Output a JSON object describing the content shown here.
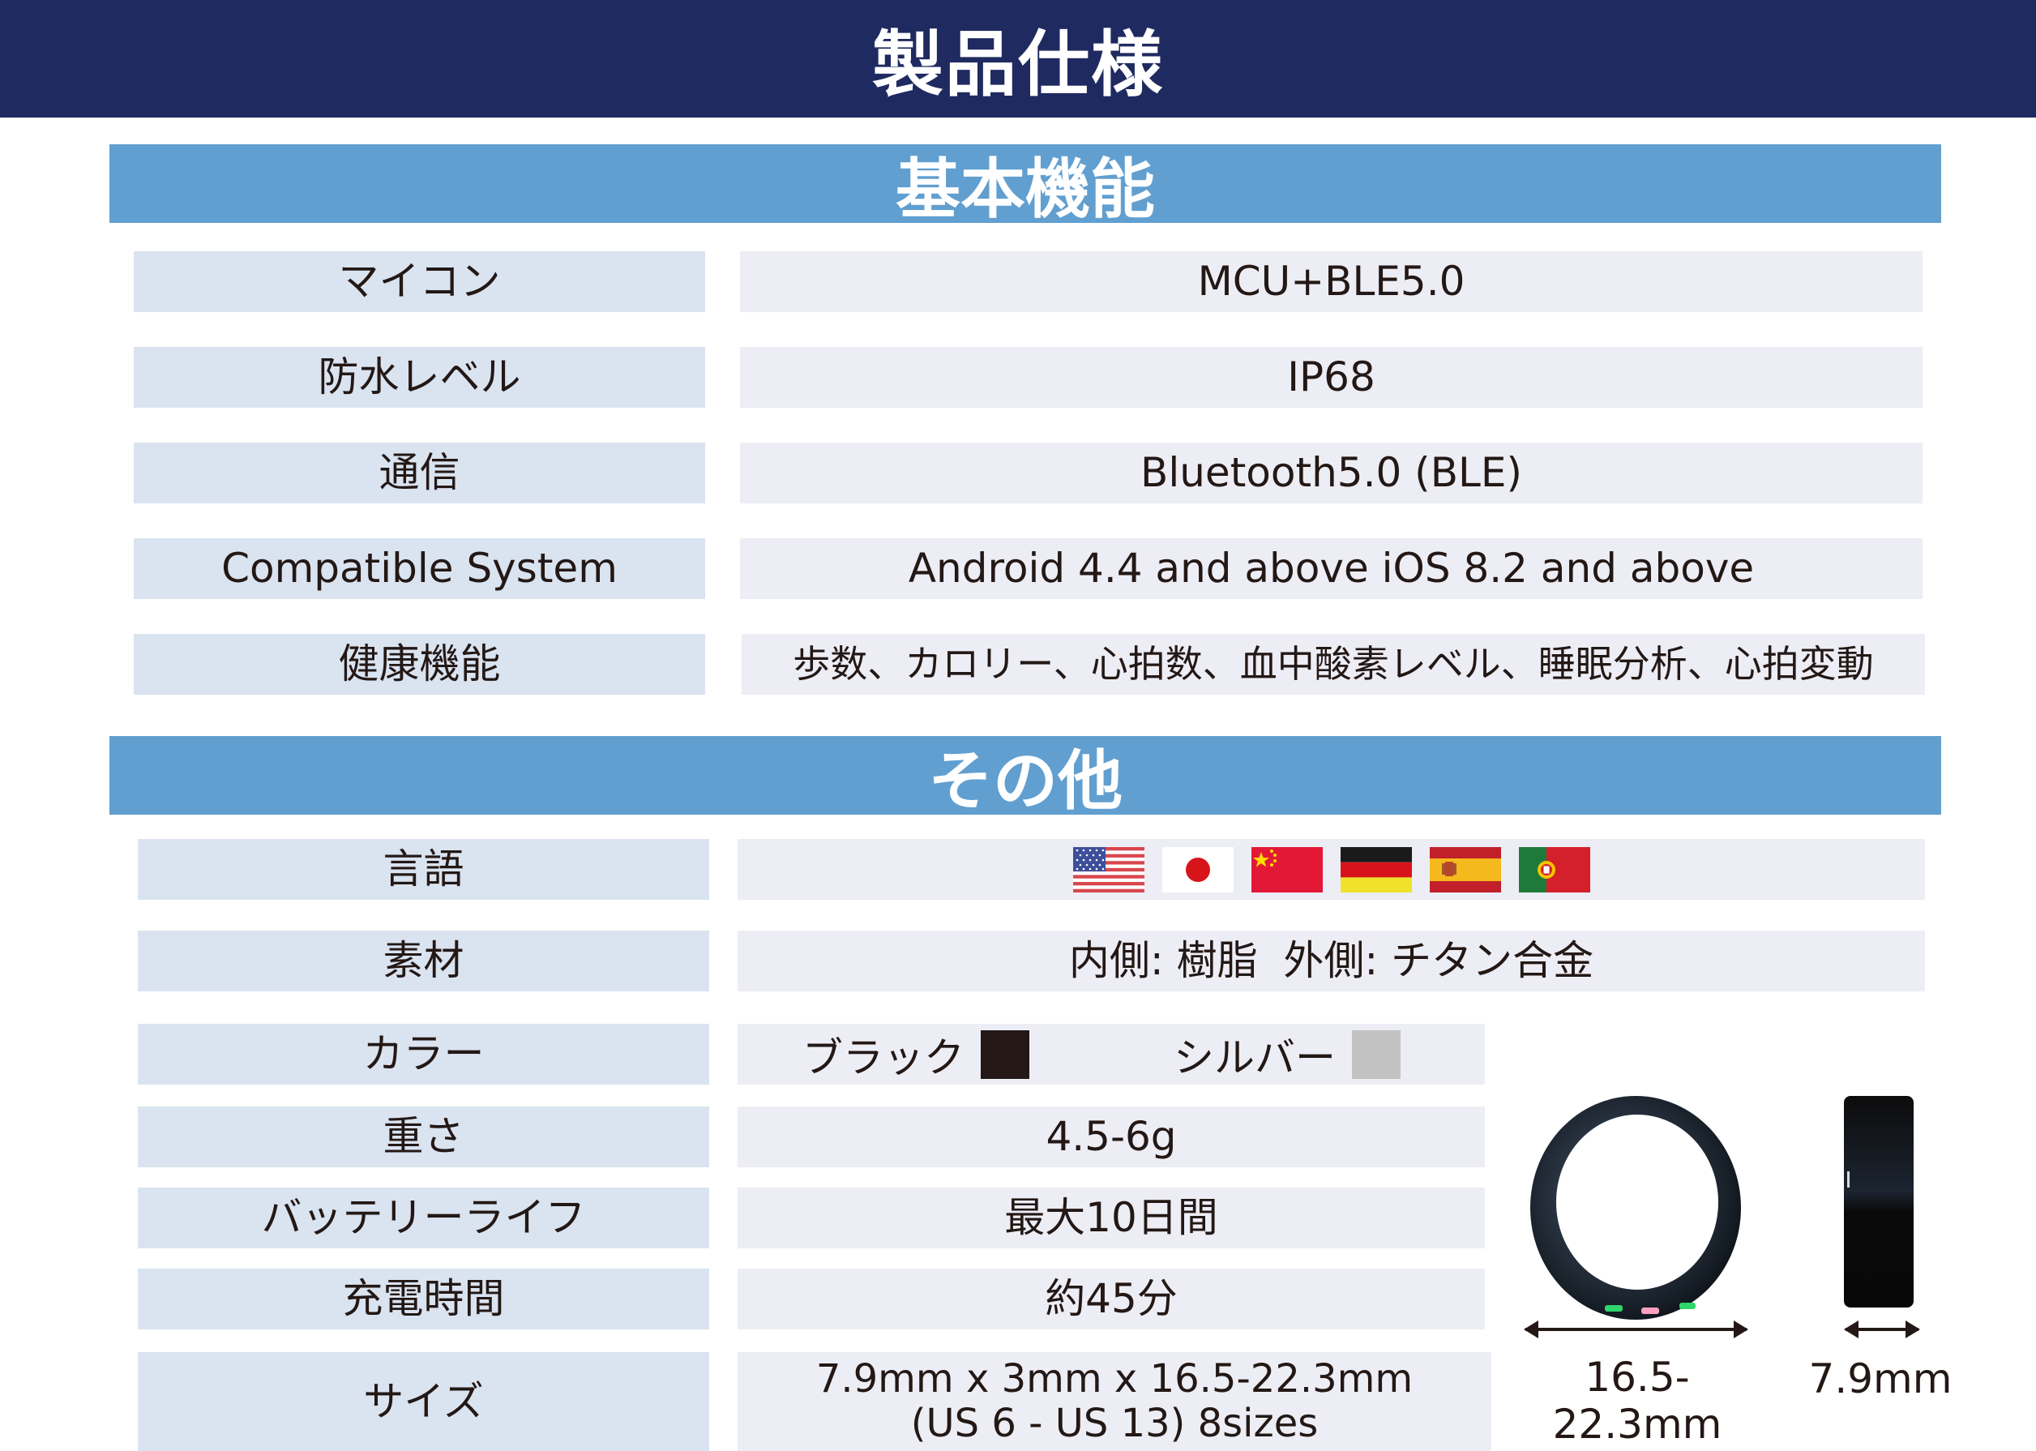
{
  "header": {
    "title": "製品仕様"
  },
  "sections": [
    {
      "title": "基本機能",
      "rows": [
        {
          "label": "マイコン",
          "value": "MCU+BLE5.0"
        },
        {
          "label": "防水レベル",
          "value": "IP68"
        },
        {
          "label": "通信",
          "value": "Bluetooth5.0 (BLE)"
        },
        {
          "label": "Compatible System",
          "value": "Android 4.4 and above iOS 8.2 and above"
        },
        {
          "label": "健康機能",
          "value": "歩数、カロリー、心拍数、血中酸素レベル、睡眠分析、心拍変動"
        }
      ]
    },
    {
      "title": "その他",
      "rows": [
        {
          "label": "言語",
          "flags": [
            "us-flag-icon",
            "japan-flag-icon",
            "china-flag-icon",
            "germany-flag-icon",
            "spain-flag-icon",
            "portugal-flag-icon"
          ]
        },
        {
          "label": "素材",
          "value": "内側: 樹脂  外側: チタン合金"
        },
        {
          "label": "カラー",
          "colors": [
            {
              "name": "ブラック",
              "hex": "#231815"
            },
            {
              "name": "シルバー",
              "hex": "#c2c2c2"
            }
          ]
        },
        {
          "label": "重さ",
          "value": "4.5-6g"
        },
        {
          "label": "バッテリーライフ",
          "value": "最大10日間"
        },
        {
          "label": "充電時間",
          "value": "約45分"
        },
        {
          "label": "サイズ",
          "value_line1": "7.9mm x 3mm x 16.5-22.3mm",
          "value_line2": "(US 6 - US 13) 8sizes"
        }
      ]
    }
  ],
  "ring_images": {
    "front_dimension": "16.5-22.3mm",
    "side_dimension": "7.9mm"
  },
  "colors": {
    "header_bg": "#1f2a60",
    "section_bar": "#619fd0",
    "label_cell": "#dae3f0",
    "value_cell": "#ededf5"
  }
}
